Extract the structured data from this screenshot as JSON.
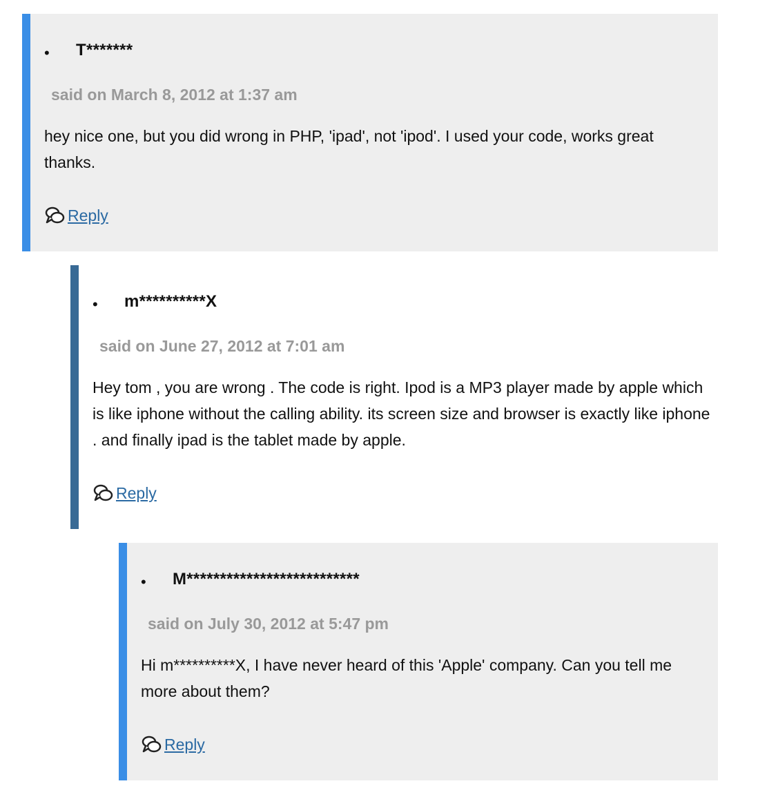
{
  "comments": [
    {
      "author": "T*******",
      "meta": "said on March 8, 2012 at 1:37 am",
      "body": "hey nice one, but you did wrong in PHP, 'ipad', not 'ipod'. I used your code, works great thanks.",
      "reply_label": "Reply"
    },
    {
      "author": "m**********X",
      "meta": "said on June 27, 2012 at 7:01 am",
      "body": "Hey tom , you are wrong . The code is right. Ipod is a MP3 player made by apple which is like iphone without the calling ability. its screen size and browser is exactly like iphone . and finally ipad is the tablet made by apple.",
      "reply_label": "Reply"
    },
    {
      "author": "M**************************",
      "meta": "said on July 30, 2012 at 5:47 pm",
      "body": "Hi m**********X, I have never heard of this 'Apple' company. Can you tell me more about them?",
      "reply_label": "Reply"
    }
  ],
  "colors": {
    "accent_blue": "#3a8ee6",
    "accent_dark": "#386a95",
    "meta_gray": "#999999",
    "link": "#2b6aa3"
  },
  "icons": {
    "reply": "reply-icon"
  }
}
